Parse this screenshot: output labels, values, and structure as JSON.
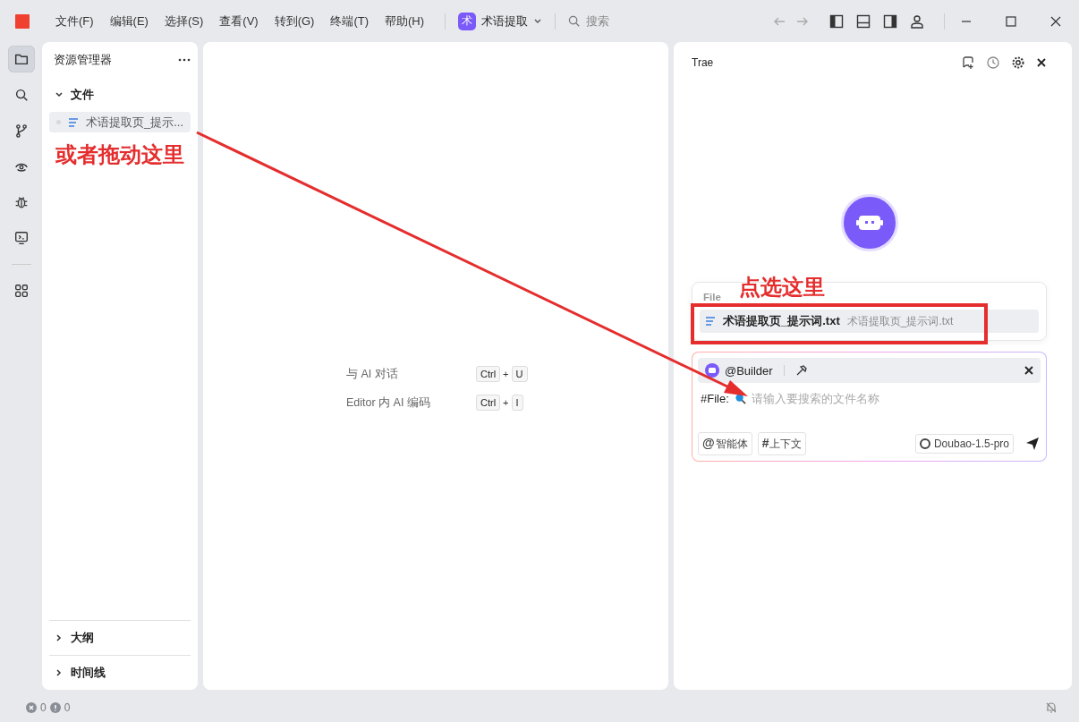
{
  "menu": [
    "文件(F)",
    "编辑(E)",
    "选择(S)",
    "查看(V)",
    "转到(G)",
    "终端(T)",
    "帮助(H)"
  ],
  "project": {
    "badge": "术",
    "name": "术语提取"
  },
  "search": {
    "placeholder": "搜索"
  },
  "activity_bar": [
    {
      "kind": "files",
      "selected": true
    },
    {
      "kind": "search",
      "selected": false
    },
    {
      "kind": "branch",
      "selected": false
    },
    {
      "kind": "eye",
      "selected": false
    },
    {
      "kind": "bug",
      "selected": false
    },
    {
      "kind": "remote",
      "selected": false
    },
    {
      "kind": "divider"
    },
    {
      "kind": "apps",
      "selected": false
    }
  ],
  "explorer": {
    "title": "资源管理器",
    "sections": [
      {
        "label": "文件",
        "expanded": true,
        "files": [
          {
            "name": "术语提取页_提示...",
            "selected": true
          }
        ]
      },
      {
        "label": "大纲",
        "expanded": false
      },
      {
        "label": "时间线",
        "expanded": false
      }
    ]
  },
  "editor": {
    "shortcuts": [
      {
        "label": "与 AI 对话",
        "keys": [
          "Ctrl",
          "U"
        ],
        "joiner": "+"
      },
      {
        "label": "Editor 内 AI 编码",
        "keys": [
          "Ctrl",
          "I"
        ],
        "joiner": "+"
      }
    ]
  },
  "chat": {
    "title": "Trae",
    "file_popup": {
      "heading": "File",
      "items": [
        {
          "name": "术语提取页_提示词.txt",
          "path": "术语提取页_提示词.txt",
          "selected": true
        }
      ]
    },
    "input": {
      "agent": "@Builder",
      "prefix": "#File:",
      "placeholder": "请输入要搜索的文件名称",
      "chips": [
        {
          "symbol": "@",
          "label": "智能体"
        },
        {
          "symbol": "#",
          "label": "上下文"
        }
      ],
      "model": "Doubao-1.5-pro"
    }
  },
  "status_bar": {
    "errors": "0",
    "warnings": "0"
  },
  "annotations": [
    {
      "kind": "label",
      "text": "或者拖动这里"
    },
    {
      "kind": "label",
      "text": "点选这里"
    },
    {
      "kind": "frame"
    },
    {
      "kind": "arrow"
    }
  ]
}
